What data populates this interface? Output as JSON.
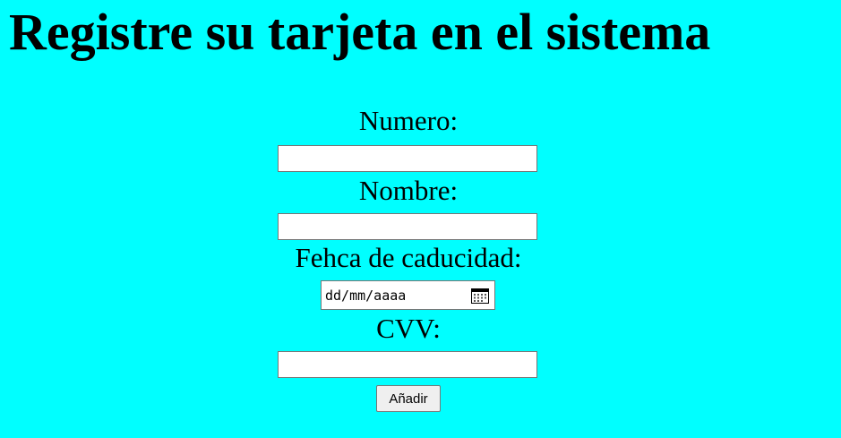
{
  "heading": "Registre su tarjeta en el sistema",
  "form": {
    "numero_label": "Numero:",
    "numero_value": "",
    "nombre_label": "Nombre:",
    "nombre_value": "",
    "fecha_label": "Fehca de caducidad:",
    "fecha_placeholder": "dd/mm/aaaa",
    "cvv_label": "CVV:",
    "cvv_value": "",
    "submit_label": "Añadir"
  },
  "icons": {
    "date_picker": "calendar-icon"
  },
  "colors": {
    "background": "#00ffff",
    "input_border": "#767676",
    "button_bg": "#efefef"
  }
}
